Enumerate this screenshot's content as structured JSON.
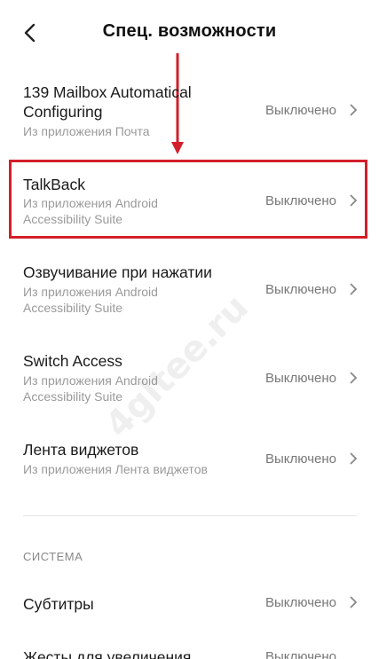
{
  "header": {
    "title": "Спец. возможности"
  },
  "items": [
    {
      "title": "139 Mailbox Automatical Configuring",
      "subtitle": "Из приложения Почта",
      "status": "Выключено"
    },
    {
      "title": "TalkBack",
      "subtitle": "Из приложения Android Accessibility Suite",
      "status": "Выключено"
    },
    {
      "title": "Озвучивание при нажатии",
      "subtitle": "Из приложения Android Accessibility Suite",
      "status": "Выключено"
    },
    {
      "title": "Switch Access",
      "subtitle": "Из приложения Android Accessibility Suite",
      "status": "Выключено"
    },
    {
      "title": "Лента виджетов",
      "subtitle": "Из приложения Лента виджетов",
      "status": "Выключено"
    }
  ],
  "section": {
    "label": "СИСТЕМА"
  },
  "system_items": [
    {
      "title": "Субтитры",
      "status": "Выключено"
    },
    {
      "title": "Жесты для увеличения",
      "status": "Выключено"
    }
  ],
  "watermark": "4gltee.ru",
  "colors": {
    "highlight": "#d21f2a",
    "arrow": "#d21f2a"
  }
}
